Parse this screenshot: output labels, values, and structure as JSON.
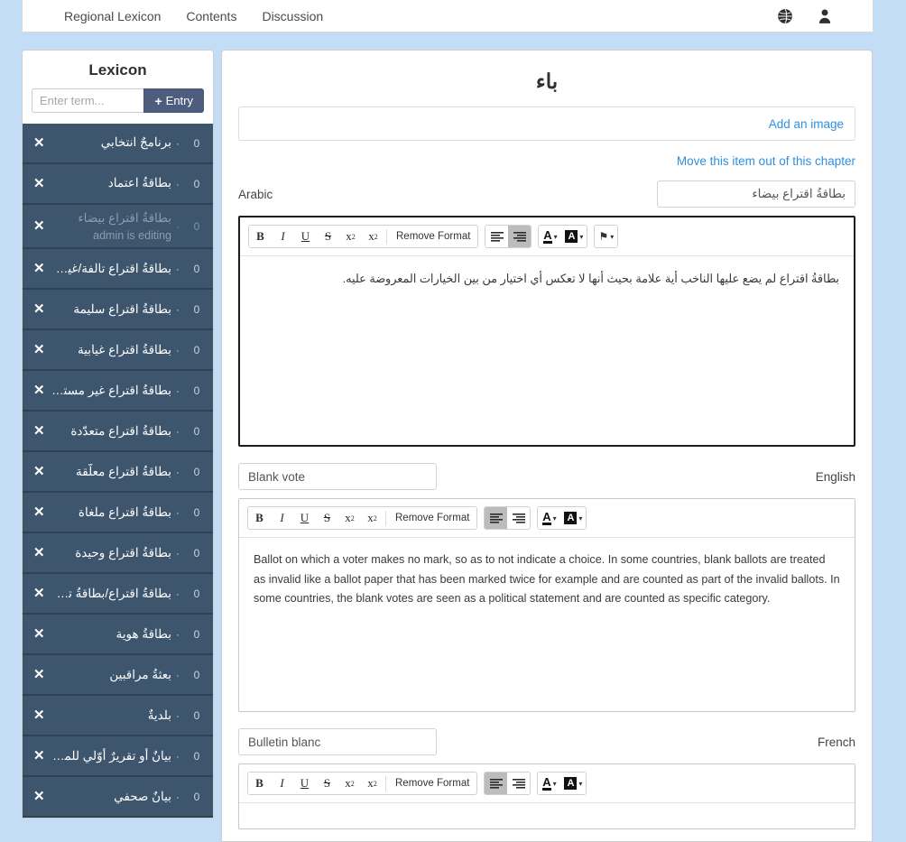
{
  "navbar": {
    "links": [
      {
        "label": "Regional Lexicon",
        "name": "nav-regional-lexicon"
      },
      {
        "label": "Contents",
        "name": "nav-contents"
      },
      {
        "label": "Discussion",
        "name": "nav-discussion"
      }
    ],
    "icons": [
      {
        "name": "globe-icon",
        "glyph": "globe"
      },
      {
        "name": "user-icon",
        "glyph": "user"
      }
    ]
  },
  "sidebar": {
    "title": "Lexicon",
    "search": {
      "value": "",
      "placeholder": "Enter term..."
    },
    "add_button": {
      "label": "Entry",
      "plus": "+"
    },
    "items": [
      {
        "term": "برنامجٌ انتخابي",
        "count": "0",
        "dot": "·",
        "close": "✕",
        "editing": false,
        "status": ""
      },
      {
        "term": "بطاقةُ اعتماد",
        "count": "0",
        "dot": "·",
        "close": "✕",
        "editing": false,
        "status": ""
      },
      {
        "term": "بطاقةُ اقتراع بيضاء",
        "count": "0",
        "dot": "·",
        "close": "✕",
        "editing": true,
        "status": "admin is editing"
      },
      {
        "term": "بطاقةُ اقتراع تالفة/غير ...",
        "count": "0",
        "dot": "·",
        "close": "✕",
        "editing": false,
        "status": ""
      },
      {
        "term": "بطاقةُ اقتراع سليمة",
        "count": "0",
        "dot": "·",
        "close": "✕",
        "editing": false,
        "status": ""
      },
      {
        "term": "بطاقةُ اقتراع غيابية",
        "count": "0",
        "dot": "·",
        "close": "✕",
        "editing": false,
        "status": ""
      },
      {
        "term": "بطاقةُ اقتراع غير مستع...",
        "count": "0",
        "dot": "·",
        "close": "✕",
        "editing": false,
        "status": ""
      },
      {
        "term": "بطاقةُ اقتراع متعدّدة",
        "count": "0",
        "dot": "·",
        "close": "✕",
        "editing": false,
        "status": ""
      },
      {
        "term": "بطاقةُ اقتراع معلّقة",
        "count": "0",
        "dot": "·",
        "close": "✕",
        "editing": false,
        "status": ""
      },
      {
        "term": "بطاقةُ اقتراع ملغاة",
        "count": "0",
        "dot": "·",
        "close": "✕",
        "editing": false,
        "status": ""
      },
      {
        "term": "بطاقةُ اقتراع وحيدة",
        "count": "0",
        "dot": "·",
        "close": "✕",
        "editing": false,
        "status": ""
      },
      {
        "term": "بطاقةُ اقتراع/بطاقةُ تص ...",
        "count": "0",
        "dot": "·",
        "close": "✕",
        "editing": false,
        "status": ""
      },
      {
        "term": "بطاقةُ هوية",
        "count": "0",
        "dot": "·",
        "close": "✕",
        "editing": false,
        "status": ""
      },
      {
        "term": "بعثةُ مراقبين",
        "count": "0",
        "dot": "·",
        "close": "✕",
        "editing": false,
        "status": ""
      },
      {
        "term": "بلديةٌ",
        "count": "0",
        "dot": "·",
        "close": "✕",
        "editing": false,
        "status": ""
      },
      {
        "term": "بيانٌ أو تقريرٌ أوّلي للمرا...",
        "count": "0",
        "dot": "·",
        "close": "✕",
        "editing": false,
        "status": ""
      },
      {
        "term": "بيانٌ صحفي",
        "count": "0",
        "dot": "·",
        "close": "✕",
        "editing": false,
        "status": ""
      }
    ]
  },
  "main": {
    "chapter_title": "باء",
    "add_image_label": "Add an image",
    "move_out_label": "Move this item out of this chapter",
    "toolbar_labels": {
      "bold": "B",
      "italic": "I",
      "underline": "U",
      "strike": "S",
      "subscript": "x",
      "superscript": "x",
      "sub_mark": "2",
      "sup_mark": "2",
      "remove_format": "Remove Format",
      "font_color_letter": "A",
      "bg_color_letter": "A",
      "caret": "▾",
      "flag": "⚑"
    },
    "sections": [
      {
        "language": "Arabic",
        "title_value": "بطاقةُ اقتراع بيضاء",
        "dir": "rtl",
        "focused": true,
        "has_flag_button": true,
        "align_active": "right",
        "body": "بطاقةُ اقتراع لم يضع عليها الناخب أية علامة بحيث أنها لا تعكس أي اختيار من بين الخيارات المعروضة عليه."
      },
      {
        "language": "English",
        "title_value": "Blank vote",
        "dir": "ltr",
        "focused": false,
        "has_flag_button": false,
        "align_active": "left",
        "body": "Ballot on which a voter makes no mark, so as to not indicate a choice. In some countries, blank ballots are treated as invalid like a ballot paper that has been marked twice for example and are counted as part of the invalid ballots. In some countries, the blank votes are seen as a political statement and are counted as specific category."
      },
      {
        "language": "French",
        "title_value": "Bulletin blanc",
        "dir": "ltr",
        "focused": false,
        "has_flag_button": false,
        "align_active": "left",
        "body": ""
      }
    ]
  }
}
